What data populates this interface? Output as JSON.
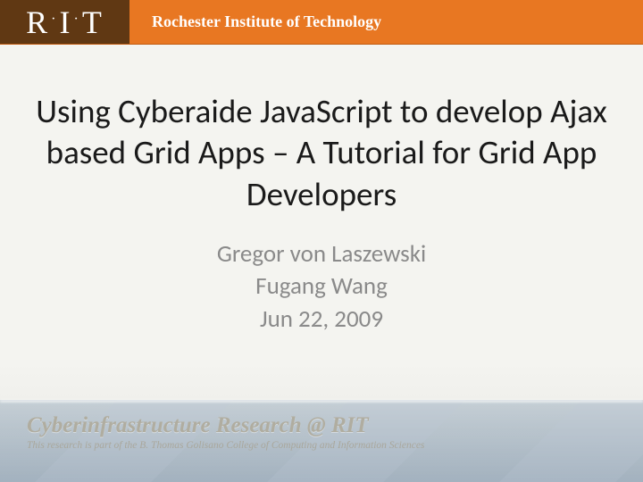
{
  "header": {
    "logo_r": "R",
    "logo_i": "I",
    "logo_t": "T",
    "institution": "Rochester Institute of Technology"
  },
  "main": {
    "title": "Using Cyberaide JavaScript to develop Ajax based Grid Apps – A Tutorial for Grid App Developers",
    "author1": "Gregor von Laszewski",
    "author2": "Fugang Wang",
    "date": "Jun 22, 2009"
  },
  "footer": {
    "title": "Cyberinfrastructure Research @ RIT",
    "subtitle": "This research is part of the B. Thomas Golisano College of Computing and Information Sciences"
  }
}
